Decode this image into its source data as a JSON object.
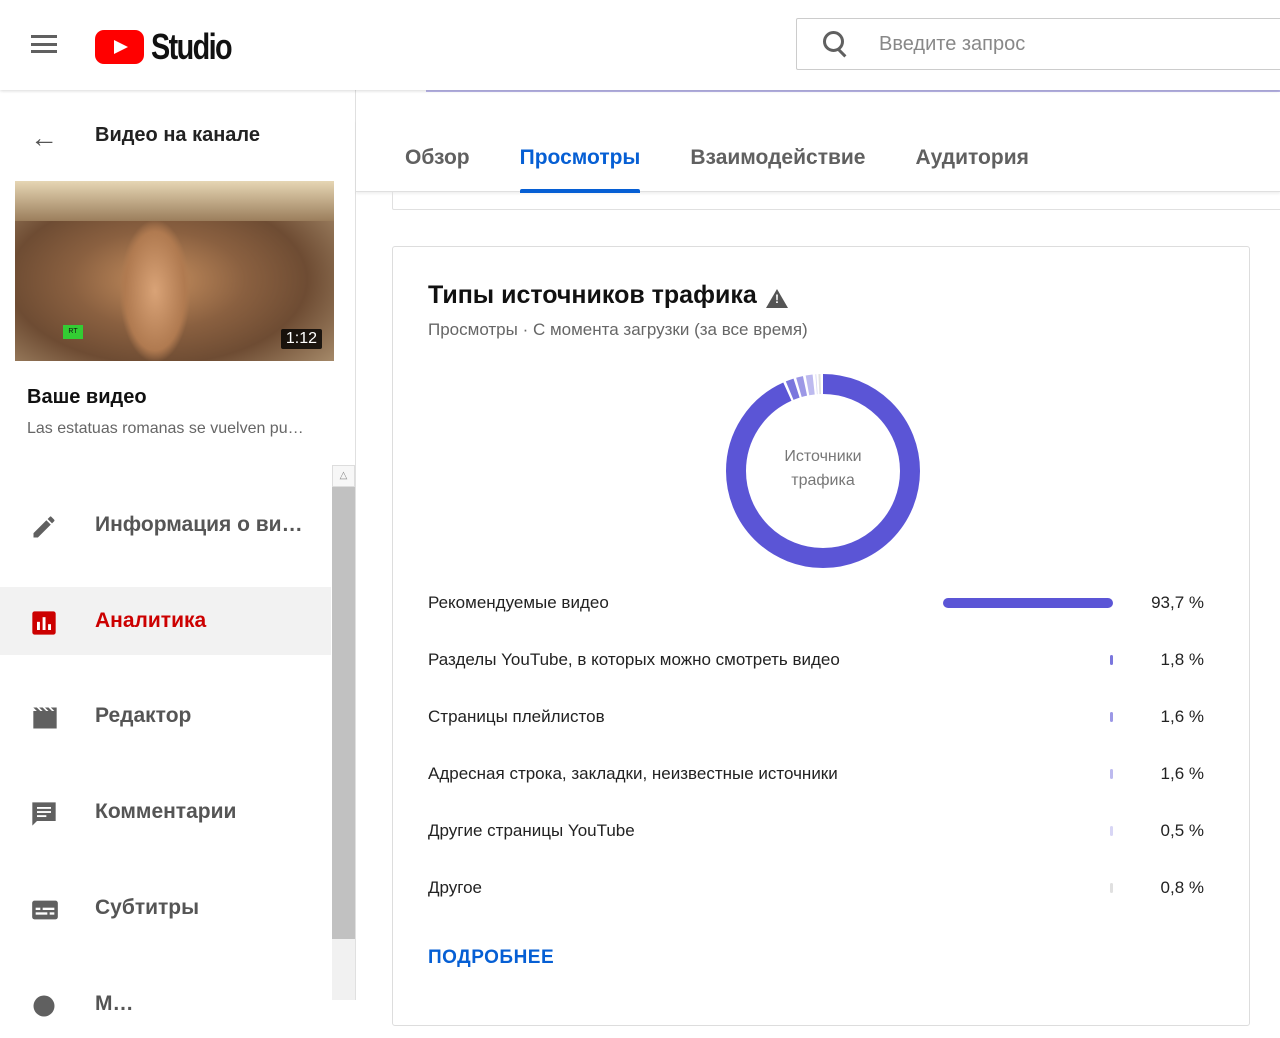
{
  "header": {
    "logo_text": "Studio",
    "search_placeholder": "Введите запрос"
  },
  "sidebar": {
    "back_title": "Видео на канале",
    "video_duration": "1:12",
    "video_badge": "RT",
    "your_video": "Ваше видео",
    "video_title": "Las estatuas romanas se vuelven pu…",
    "items": [
      {
        "label": "Информация о ви…",
        "icon": "pencil-icon"
      },
      {
        "label": "Аналитика",
        "icon": "analytics-icon",
        "active": true
      },
      {
        "label": "Редактор",
        "icon": "clapper-icon"
      },
      {
        "label": "Комментарии",
        "icon": "comment-icon"
      },
      {
        "label": "Субтитры",
        "icon": "subtitles-icon"
      },
      {
        "label": "М…",
        "icon": "money-icon"
      }
    ]
  },
  "tabs": [
    {
      "label": "Обзор"
    },
    {
      "label": "Просмотры",
      "active": true
    },
    {
      "label": "Взаимодействие"
    },
    {
      "label": "Аудитория"
    }
  ],
  "card": {
    "title": "Типы источников трафика",
    "subtitle": "Просмотры · С момента загрузки (за все время)",
    "donut_label_1": "Источники",
    "donut_label_2": "трафика",
    "more": "ПОДРОБНЕЕ",
    "rows": [
      {
        "label": "Рекомендуемые видео",
        "pct": "93,7 %",
        "value": 93.7,
        "color": "#5b55d6"
      },
      {
        "label": "Разделы YouTube, в которых можно смотреть видео",
        "pct": "1,8 %",
        "value": 1.8,
        "color": "#7a76dd"
      },
      {
        "label": "Страницы плейлистов",
        "pct": "1,6 %",
        "value": 1.6,
        "color": "#9c98e6"
      },
      {
        "label": "Адресная строка, закладки, неизвестные источники",
        "pct": "1,6 %",
        "value": 1.6,
        "color": "#bdbaef"
      },
      {
        "label": "Другие страницы YouTube",
        "pct": "0,5 %",
        "value": 0.5,
        "color": "#d8d6f5"
      },
      {
        "label": "Другое",
        "pct": "0,8 %",
        "value": 0.8,
        "color": "#e0e0e0"
      }
    ]
  }
}
